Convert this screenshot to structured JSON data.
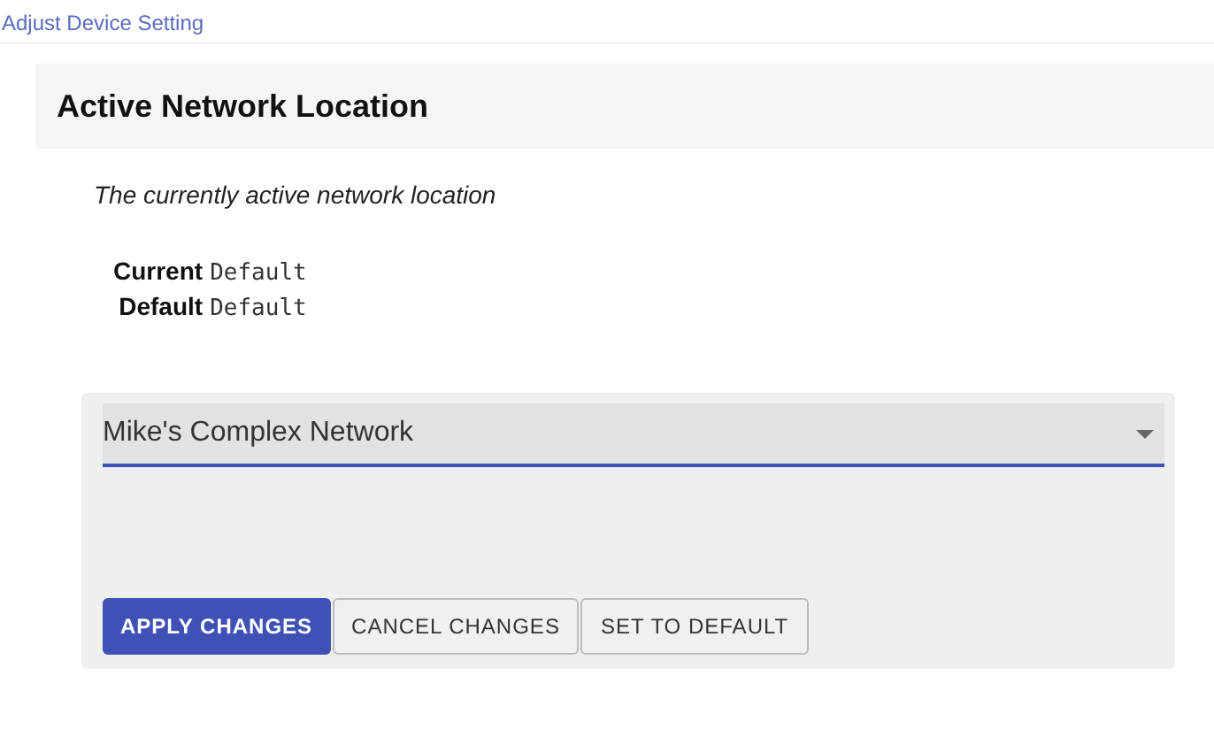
{
  "breadcrumb": "Adjust Device Setting",
  "section": {
    "title": "Active Network Location",
    "description": "The currently active network location"
  },
  "values": [
    {
      "label": "Current",
      "value": "Default"
    },
    {
      "label": "Default",
      "value": "Default"
    }
  ],
  "select": {
    "value": "Mike's Complex Network"
  },
  "buttons": [
    {
      "label": "APPLY CHANGES",
      "kind": "primary"
    },
    {
      "label": "CANCEL CHANGES",
      "kind": "outlined"
    },
    {
      "label": "SET TO DEFAULT",
      "kind": "outlined"
    }
  ]
}
